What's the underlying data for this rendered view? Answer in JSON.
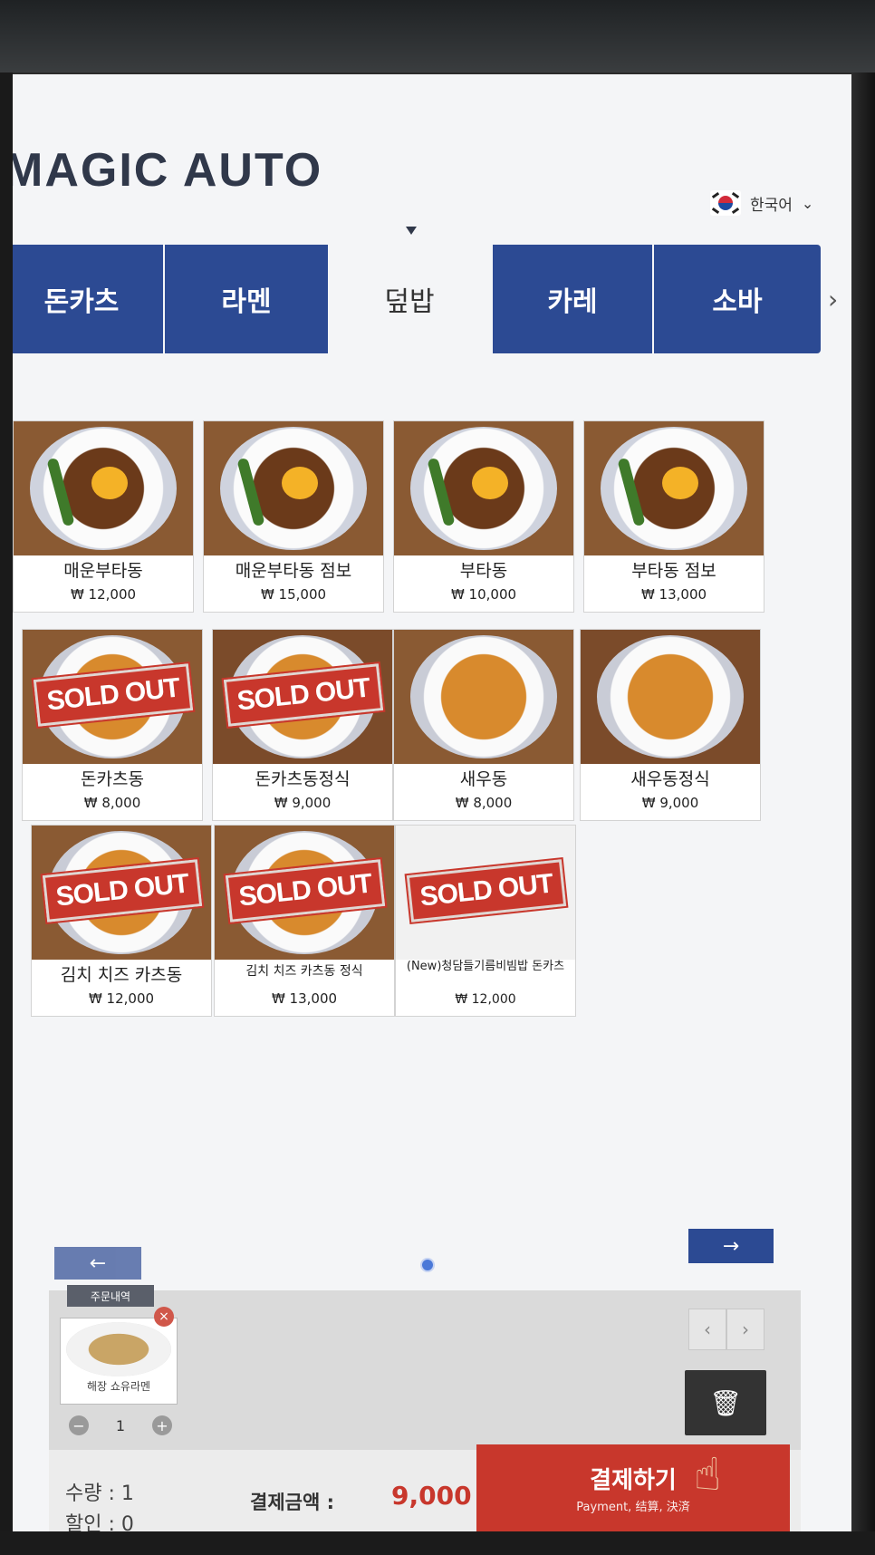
{
  "header": {
    "brand": "MAGIC AUTO",
    "language": "한국어"
  },
  "tabs": [
    {
      "label": "돈카츠",
      "active": false
    },
    {
      "label": "라멘",
      "active": false
    },
    {
      "label": "덮밥",
      "active": true
    },
    {
      "label": "카레",
      "active": false
    },
    {
      "label": "소바",
      "active": false
    }
  ],
  "menu": [
    {
      "name": "매운부타동",
      "price": "₩ 12,000",
      "sold_out": false
    },
    {
      "name": "매운부타동 점보",
      "price": "₩ 15,000",
      "sold_out": false
    },
    {
      "name": "부타동",
      "price": "₩ 10,000",
      "sold_out": false
    },
    {
      "name": "부타동 점보",
      "price": "₩ 13,000",
      "sold_out": false
    },
    {
      "name": "돈카츠동",
      "price": "₩ 8,000",
      "sold_out": true
    },
    {
      "name": "돈카츠동정식",
      "price": "₩ 9,000",
      "sold_out": true
    },
    {
      "name": "새우동",
      "price": "₩ 8,000",
      "sold_out": false
    },
    {
      "name": "새우동정식",
      "price": "₩ 9,000",
      "sold_out": false
    },
    {
      "name": "김치 치즈 카츠동",
      "price": "₩ 12,000",
      "sold_out": true
    },
    {
      "name": "김치 치즈 카츠동 정식",
      "price": "₩ 13,000",
      "sold_out": true
    },
    {
      "name": "(New)청담들기름비빔밥 돈카츠",
      "price": "₩ 12,000",
      "sold_out": true
    }
  ],
  "sold_out_label": "SOLD OUT",
  "order": {
    "tag": "주문내역",
    "item_name": "해장 쇼유라멘",
    "quantity": "1"
  },
  "footer": {
    "qty_label": "수량 : 1",
    "discount_label": "할인 : 0",
    "total_label": "결제금액 :",
    "total_value": "9,000",
    "pay_label": "결제하기",
    "pay_sub": "Payment, 结算, 決済"
  },
  "colors": {
    "navy": "#2c4a93",
    "red": "#c8372c"
  }
}
